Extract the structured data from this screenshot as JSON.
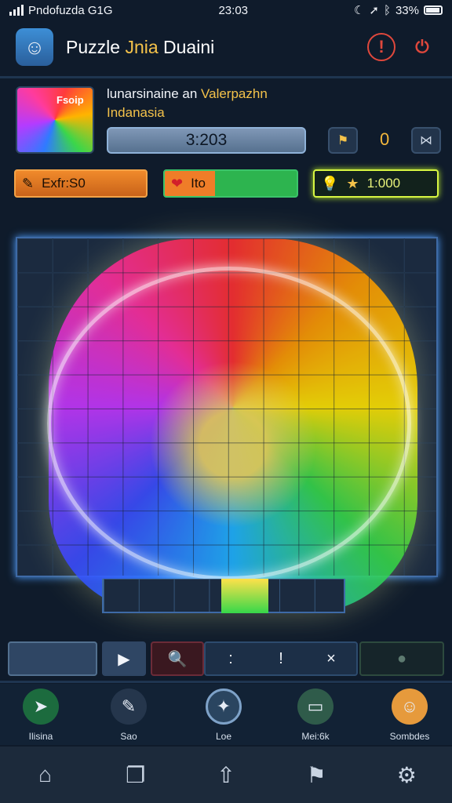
{
  "status": {
    "carrier": "Pndofuzda G1G",
    "time": "23:03",
    "battery": "33%",
    "icons": [
      "signal-icon",
      "moon-icon",
      "location-arrow-icon",
      "bluetooth-icon",
      "battery-icon"
    ]
  },
  "header": {
    "title_main": "Puzzle",
    "title_accent": "Jnia",
    "title_end": "Duaini",
    "icons": [
      "avatar-icon",
      "alert-icon",
      "exit-icon"
    ]
  },
  "info": {
    "thumb_label": "Fsoip",
    "line1_main": "lunarsinaine an",
    "line1_accent": "Valerpazhn",
    "line2": "Indanasia",
    "progress_value": "3:203",
    "moves": "0"
  },
  "pills": {
    "orange_label": "Exfr:S0",
    "split_label": "Ito",
    "green_label": "1:000"
  },
  "toolbar": {
    "dots": ":",
    "bang": "!",
    "close": "×"
  },
  "tabs": [
    {
      "label": "Ilisina",
      "icon": "share-icon"
    },
    {
      "label": "Sao",
      "icon": "pin-icon"
    },
    {
      "label": "Loe",
      "icon": "puzzle-icon"
    },
    {
      "label": "Mei:6k",
      "icon": "monitor-icon"
    },
    {
      "label": "Sombdes",
      "icon": "character-icon"
    }
  ],
  "nav": [
    "home-icon",
    "recent-apps-icon",
    "upload-icon",
    "bookmark-icon",
    "settings-icon"
  ],
  "colors": {
    "background": "#0f1b2b",
    "accent_yellow": "#f4c24a",
    "alert_red": "#e0483c",
    "board_glow": "#4fa0ff"
  }
}
